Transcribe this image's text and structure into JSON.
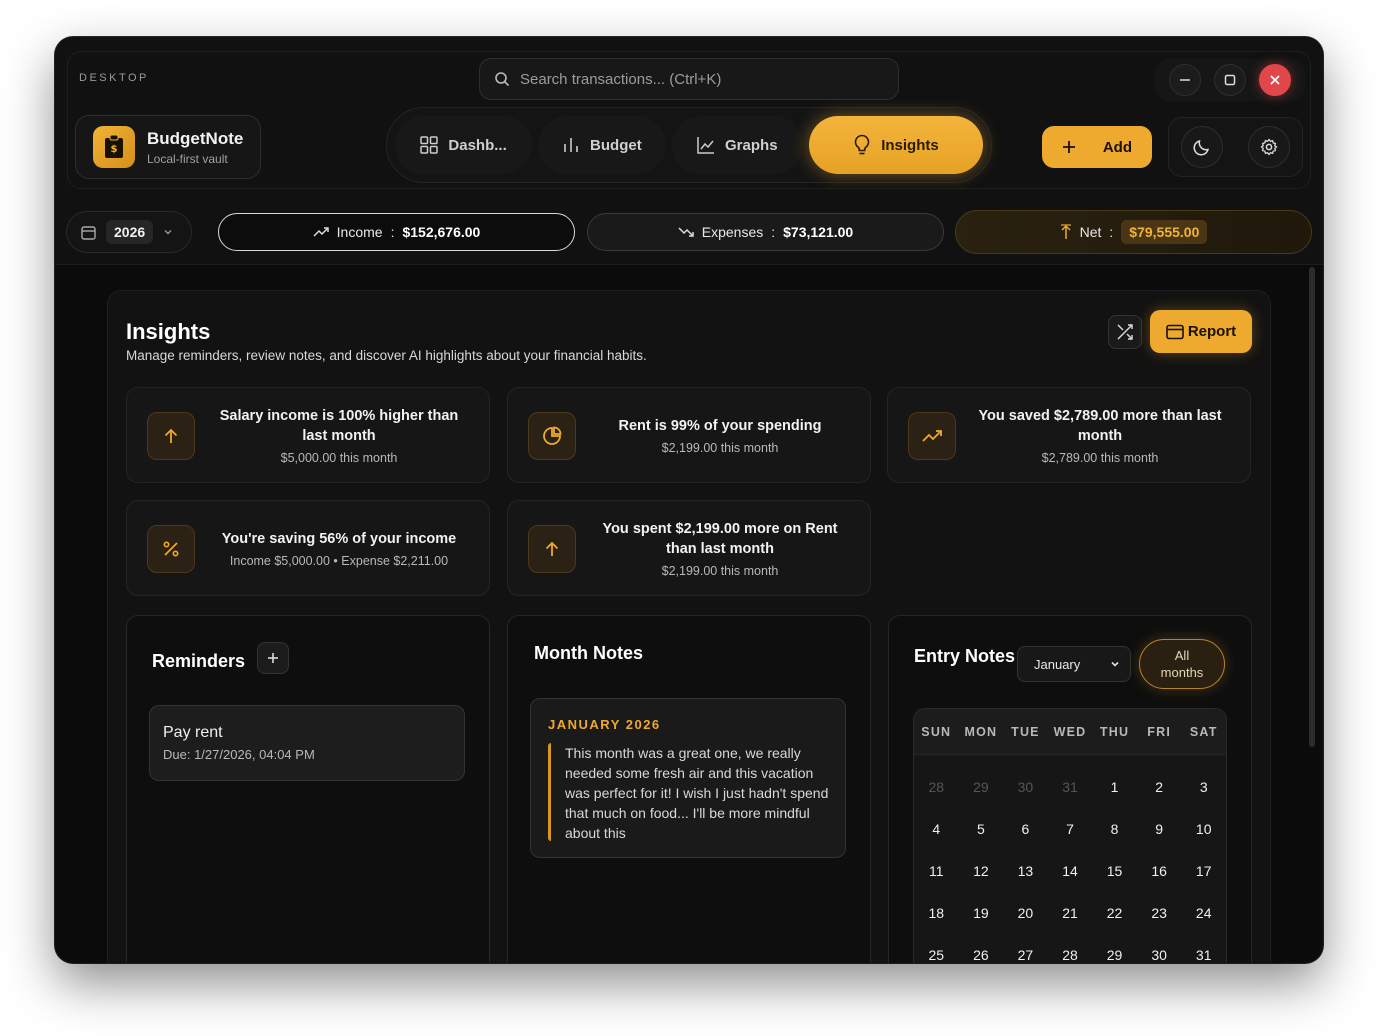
{
  "app": {
    "section_label": "DESKTOP",
    "brand_title": "BudgetNote",
    "brand_subtitle": "Local-first vault"
  },
  "search": {
    "placeholder": "Search transactions... (Ctrl+K)"
  },
  "nav": {
    "tabs": [
      {
        "label": "Dashb...",
        "icon": "grid-icon",
        "active": false
      },
      {
        "label": "Budget",
        "icon": "bar-chart-icon",
        "active": false
      },
      {
        "label": "Graphs",
        "icon": "line-chart-icon",
        "active": true
      },
      {
        "label": "Insights",
        "icon": "lightbulb-icon",
        "active": true
      }
    ]
  },
  "toolbar": {
    "add_label": "Add"
  },
  "stats": {
    "year": "2026",
    "income_label": "Income",
    "income_value": "$152,676.00",
    "expenses_label": "Expenses",
    "expenses_value": "$73,121.00",
    "net_label": "Net",
    "net_value": "$79,555.00",
    "separator": ":"
  },
  "insights": {
    "title": "Insights",
    "subtitle": "Manage reminders, review notes, and discover AI highlights about your financial habits.",
    "report_label": "Report",
    "cards": [
      {
        "title": "Salary income is 100% higher than last month",
        "sub": "$5,000.00 this month",
        "icon": "arrow-up-icon"
      },
      {
        "title": "Rent is 99% of your spending",
        "sub": "$2,199.00 this month",
        "icon": "pie-chart-icon"
      },
      {
        "title": "You saved $2,789.00 more than last month",
        "sub": "$2,789.00 this month",
        "icon": "trending-up-icon"
      },
      {
        "title": "You're saving 56% of your income",
        "sub": "Income $5,000.00 • Expense $2,211.00",
        "icon": "percent-icon"
      },
      {
        "title": "You spent $2,199.00 more on Rent than last month",
        "sub": "$2,199.00 this month",
        "icon": "arrow-up-icon"
      }
    ]
  },
  "reminders": {
    "title": "Reminders",
    "items": [
      {
        "title": "Pay rent",
        "due": "Due: 1/27/2026, 04:04 PM"
      }
    ]
  },
  "month_notes": {
    "title": "Month Notes",
    "note_month": "JANUARY 2026",
    "note_text": "This month was a great one, we really needed some fresh air and this vacation was perfect for it! I wish I just hadn't spend that much on food... I'll be more mindful about this"
  },
  "entry_notes": {
    "title": "Entry Notes",
    "selected_month": "January",
    "all_months_label": "All months",
    "weekdays": [
      "SUN",
      "MON",
      "TUE",
      "WED",
      "THU",
      "FRI",
      "SAT"
    ],
    "days": [
      {
        "d": "28",
        "muted": true
      },
      {
        "d": "29",
        "muted": true
      },
      {
        "d": "30",
        "muted": true
      },
      {
        "d": "31",
        "muted": true
      },
      {
        "d": "1"
      },
      {
        "d": "2"
      },
      {
        "d": "3"
      },
      {
        "d": "4"
      },
      {
        "d": "5"
      },
      {
        "d": "6"
      },
      {
        "d": "7"
      },
      {
        "d": "8"
      },
      {
        "d": "9"
      },
      {
        "d": "10"
      },
      {
        "d": "11"
      },
      {
        "d": "12"
      },
      {
        "d": "13"
      },
      {
        "d": "14"
      },
      {
        "d": "15"
      },
      {
        "d": "16"
      },
      {
        "d": "17"
      },
      {
        "d": "18"
      },
      {
        "d": "19"
      },
      {
        "d": "20"
      },
      {
        "d": "21"
      },
      {
        "d": "22"
      },
      {
        "d": "23"
      },
      {
        "d": "24"
      },
      {
        "d": "25"
      },
      {
        "d": "26"
      },
      {
        "d": "27"
      },
      {
        "d": "28"
      },
      {
        "d": "29"
      },
      {
        "d": "30"
      },
      {
        "d": "31"
      }
    ]
  },
  "colors": {
    "accent": "#eeaa2e",
    "background": "#0b0b0b",
    "close": "#e0464a"
  }
}
